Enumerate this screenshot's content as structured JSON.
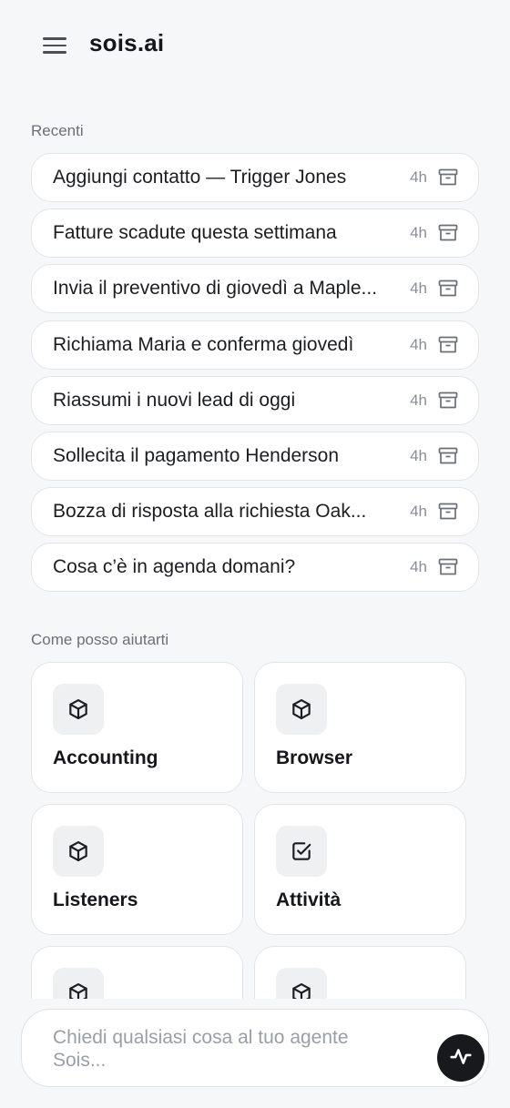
{
  "header": {
    "menu_icon": "hamburger-menu-icon",
    "app_title": "sois.ai"
  },
  "recents": {
    "label": "Recenti",
    "items": [
      {
        "title": "Aggiungi contatto — Trigger Jones",
        "time": "4h",
        "icon": "archive-icon"
      },
      {
        "title": "Fatture scadute questa settimana",
        "time": "4h",
        "icon": "archive-icon"
      },
      {
        "title": "Invia il preventivo di giovedì a Maple...",
        "time": "4h",
        "icon": "archive-icon"
      },
      {
        "title": "Richiama Maria e conferma giovedì",
        "time": "4h",
        "icon": "archive-icon"
      },
      {
        "title": "Riassumi i nuovi lead di oggi",
        "time": "4h",
        "icon": "archive-icon"
      },
      {
        "title": "Sollecita il pagamento Henderson",
        "time": "4h",
        "icon": "archive-icon"
      },
      {
        "title": "Bozza di risposta alla richiesta Oak...",
        "time": "4h",
        "icon": "archive-icon"
      },
      {
        "title": "Cosa c’è in agenda domani?",
        "time": "4h",
        "icon": "archive-icon"
      }
    ]
  },
  "help": {
    "label": "Come posso aiutarti",
    "cards": [
      {
        "label": "Accounting",
        "icon": "cube-icon"
      },
      {
        "label": "Browser",
        "icon": "cube-icon"
      },
      {
        "label": "Listeners",
        "icon": "cube-icon"
      },
      {
        "label": "Attività",
        "icon": "checkbox-icon"
      },
      {
        "label": "",
        "icon": "cube-icon"
      },
      {
        "label": "",
        "icon": "cube-icon"
      }
    ]
  },
  "composer": {
    "placeholder": "Chiedi qualsiasi cosa al tuo agente Sois...",
    "value": "",
    "send_icon": "activity-wave-icon"
  },
  "colors": {
    "background": "#f6f7f8",
    "card": "#ffffff",
    "border": "#e2e4e8",
    "icon_tile": "#eef0f2",
    "send_button": "#17191c"
  }
}
